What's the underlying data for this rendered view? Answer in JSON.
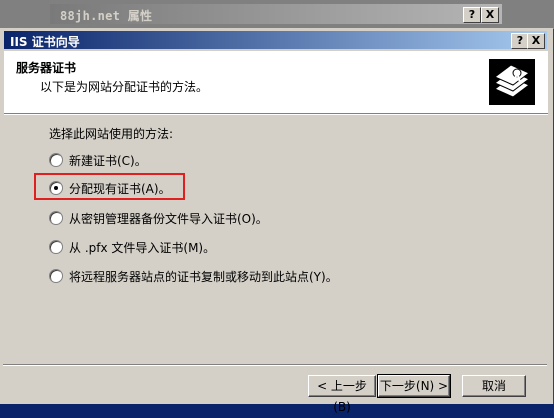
{
  "parent_window": {
    "title": "88jh.net 属性",
    "help_glyph": "?",
    "close_glyph": "X"
  },
  "wizard": {
    "title": "IIS 证书向导",
    "help_glyph": "?",
    "close_glyph": "X",
    "header": {
      "title": "服务器证书",
      "subtitle": "以下是为网站分配证书的方法。",
      "icon": "certificate-stack-icon"
    },
    "prompt": "选择此网站使用的方法:",
    "options": [
      {
        "label": "新建证书(C)。",
        "checked": false
      },
      {
        "label": "分配现有证书(A)。",
        "checked": true
      },
      {
        "label": "从密钥管理器备份文件导入证书(O)。",
        "checked": false
      },
      {
        "label": "从 .pfx 文件导入证书(M)。",
        "checked": false
      },
      {
        "label": "将远程服务器站点的证书复制或移动到此站点(Y)。",
        "checked": false
      }
    ],
    "buttons": {
      "back": "< 上一步(B)",
      "next": "下一步(N) >",
      "cancel": "取消"
    }
  },
  "colors": {
    "highlight": "#e02020",
    "title_bar": "#0a246a",
    "dialog_bg": "#d4d0c8"
  }
}
